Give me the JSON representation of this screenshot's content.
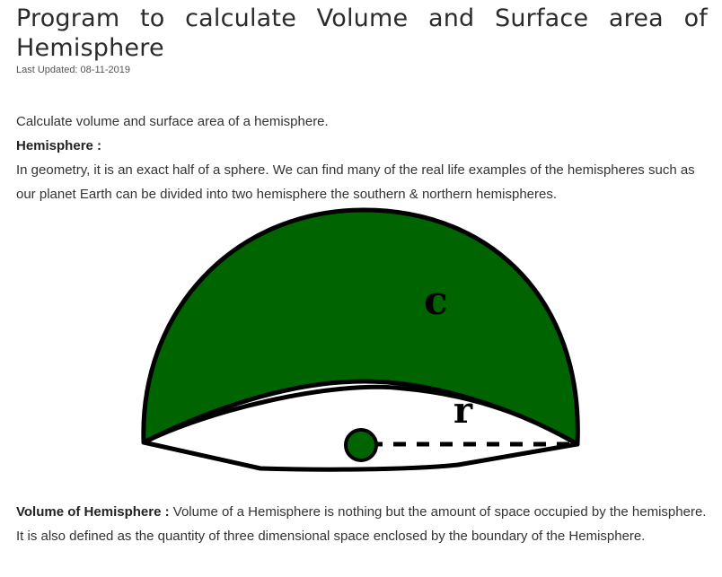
{
  "article": {
    "title": "Program to calculate Volume and Surface area of Hemisphere",
    "last_updated": "Last Updated: 08-11-2019",
    "intro": "Calculate volume and surface area of a hemisphere.",
    "hemisphere_label": "Hemisphere :",
    "hemisphere_text": "In geometry, it is an exact half of a sphere. We can find many of the real life examples of the hemispheres such as our planet Earth can be divided into two hemisphere the southern & northern hemispheres.",
    "volume_label": "Volume of Hemisphere :",
    "volume_text": " Volume of a Hemisphere is nothing but the amount of space occupied by the hemisphere. It is also defined as the quantity of three dimensional space enclosed by the boundary of the Hemisphere."
  },
  "figure": {
    "label_c": "c",
    "label_r": "r",
    "dome_color": "#006400",
    "outline_color": "#000000",
    "base_color": "#ffffff"
  }
}
